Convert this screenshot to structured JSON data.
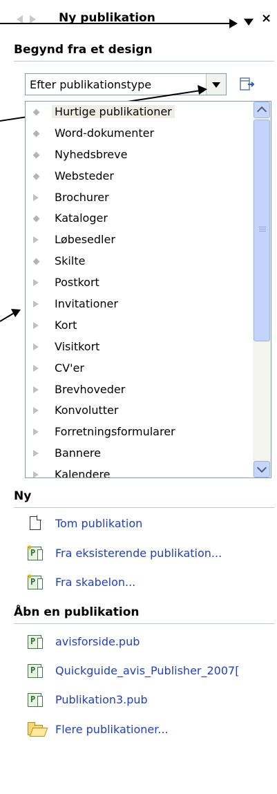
{
  "header": {
    "title": "Ny publikation",
    "close": "×"
  },
  "design": {
    "heading": "Begynd fra et design",
    "dropdown_value": "Efter publikationstype",
    "items": [
      {
        "label": "Hurtige publikationer",
        "bullet": "dot",
        "selected": true
      },
      {
        "label": "Word-dokumenter",
        "bullet": "dot"
      },
      {
        "label": "Nyhedsbreve",
        "bullet": "dot"
      },
      {
        "label": "Websteder",
        "bullet": "dot"
      },
      {
        "label": "Brochurer",
        "bullet": "triangle"
      },
      {
        "label": "Kataloger",
        "bullet": "dot"
      },
      {
        "label": "Løbesedler",
        "bullet": "triangle"
      },
      {
        "label": "Skilte",
        "bullet": "dot"
      },
      {
        "label": "Postkort",
        "bullet": "triangle"
      },
      {
        "label": "Invitationer",
        "bullet": "triangle"
      },
      {
        "label": "Kort",
        "bullet": "triangle"
      },
      {
        "label": "Visitkort",
        "bullet": "triangle"
      },
      {
        "label": "CV'er",
        "bullet": "triangle"
      },
      {
        "label": "Brevhoveder",
        "bullet": "triangle"
      },
      {
        "label": "Konvolutter",
        "bullet": "triangle"
      },
      {
        "label": "Forretningsformularer",
        "bullet": "triangle"
      },
      {
        "label": "Bannere",
        "bullet": "triangle"
      },
      {
        "label": "Kalendere",
        "bullet": "triangle"
      }
    ]
  },
  "new": {
    "heading": "Ny",
    "items": [
      {
        "label": "Tom publikation",
        "icon": "blank-document-icon"
      },
      {
        "label": "Fra eksisterende publikation...",
        "icon": "publication-new-icon"
      },
      {
        "label": "Fra skabelon...",
        "icon": "publication-new-icon"
      }
    ]
  },
  "open": {
    "heading": "Åbn en publikation",
    "items": [
      {
        "label": "avisforside.pub",
        "icon": "publisher-file-icon"
      },
      {
        "label": "Quickguide_avis_Publisher_2007[",
        "icon": "publisher-file-icon"
      },
      {
        "label": "Publikation3.pub",
        "icon": "publisher-file-icon"
      },
      {
        "label": "Flere publikationer...",
        "icon": "open-folder-icon"
      }
    ]
  }
}
